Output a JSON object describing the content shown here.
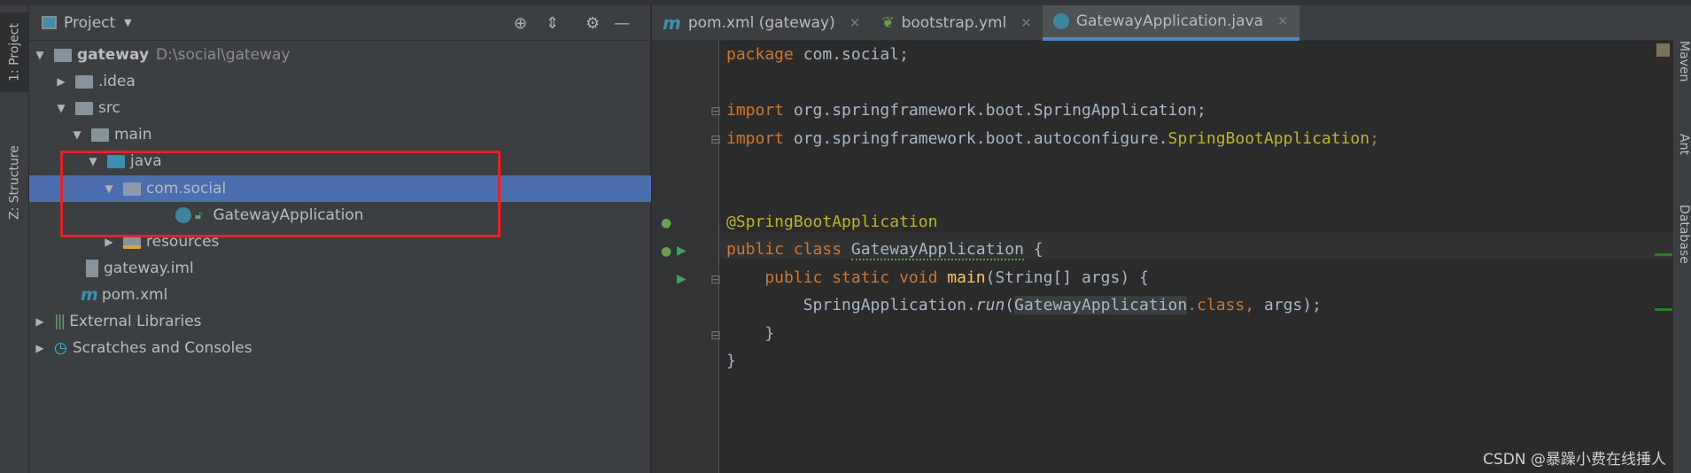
{
  "left_strip": {
    "project_tab": "1: Project",
    "structure_tab": "Z: Structure"
  },
  "project_panel": {
    "title": "Project",
    "tree": [
      {
        "label": "gateway",
        "path": "D:\\social\\gateway"
      },
      {
        "label": ".idea"
      },
      {
        "label": "src"
      },
      {
        "label": "main"
      },
      {
        "label": "java"
      },
      {
        "label": "com.social"
      },
      {
        "label": "GatewayApplication"
      },
      {
        "label": "resources"
      },
      {
        "label": "gateway.iml"
      },
      {
        "label": "pom.xml"
      },
      {
        "label": "External Libraries"
      },
      {
        "label": "Scratches and Consoles"
      }
    ]
  },
  "editor_tabs": [
    {
      "label": "pom.xml (gateway)",
      "icon": "maven-icon"
    },
    {
      "label": "bootstrap.yml",
      "icon": "spring-leaf-icon"
    },
    {
      "label": "GatewayApplication.java",
      "icon": "spring-boot-class-icon",
      "active": true
    }
  ],
  "code": {
    "l1a": "package",
    "l1b": " com.social;",
    "l3a": "import",
    "l3b": " org.springframework.boot.SpringApplication;",
    "l4a": "import",
    "l4b": " org.springframework.boot.autoconfigure.",
    "l4c": "SpringBootApplication",
    "l4d": ";",
    "l7": "@SpringBootApplication",
    "l8a": "public class ",
    "l8b": "GatewayApplication",
    "l8c": " {",
    "l9a": "    public static void ",
    "l9b": "main",
    "l9c": "(String[] args) {",
    "l10a": "        SpringApplication.",
    "l10b": "run",
    "l10c": "(",
    "l10d": "GatewayApplication",
    "l10e": ".class,",
    "l10f": " args);",
    "l11": "    }",
    "l12": "}"
  },
  "right_strip": {
    "maven": "Maven",
    "ant": "Ant",
    "database": "Database"
  },
  "watermark": "CSDN @暴躁小费在线捶人",
  "colors": {
    "selection": "#4b6eaf",
    "highlight_box": "#e8202a",
    "keyword": "#cc7832",
    "annotation": "#bbb529"
  }
}
